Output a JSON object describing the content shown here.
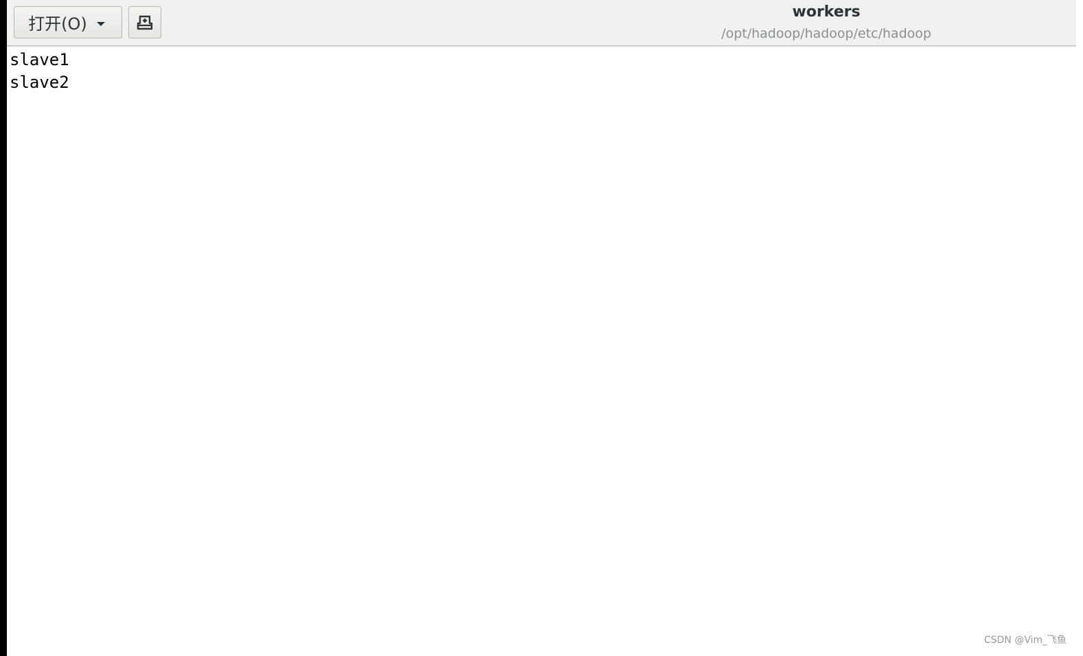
{
  "toolbar": {
    "open_label": "打开(O)",
    "open_icon": "chevron-down-icon",
    "new_doc_icon": "new-document-icon"
  },
  "header": {
    "title": "workers",
    "subtitle": "/opt/hadoop/hadoop/etc/hadoop"
  },
  "editor": {
    "lines": [
      "slave1",
      "slave2"
    ]
  },
  "watermark": {
    "text": "CSDN @Vim_飞鱼"
  },
  "colors": {
    "headerbar_bg": "#f1f1f1",
    "title_color": "#2e3436",
    "subtitle_color": "#8b8e8f",
    "editor_bg": "#ffffff",
    "text_color": "#000000"
  }
}
